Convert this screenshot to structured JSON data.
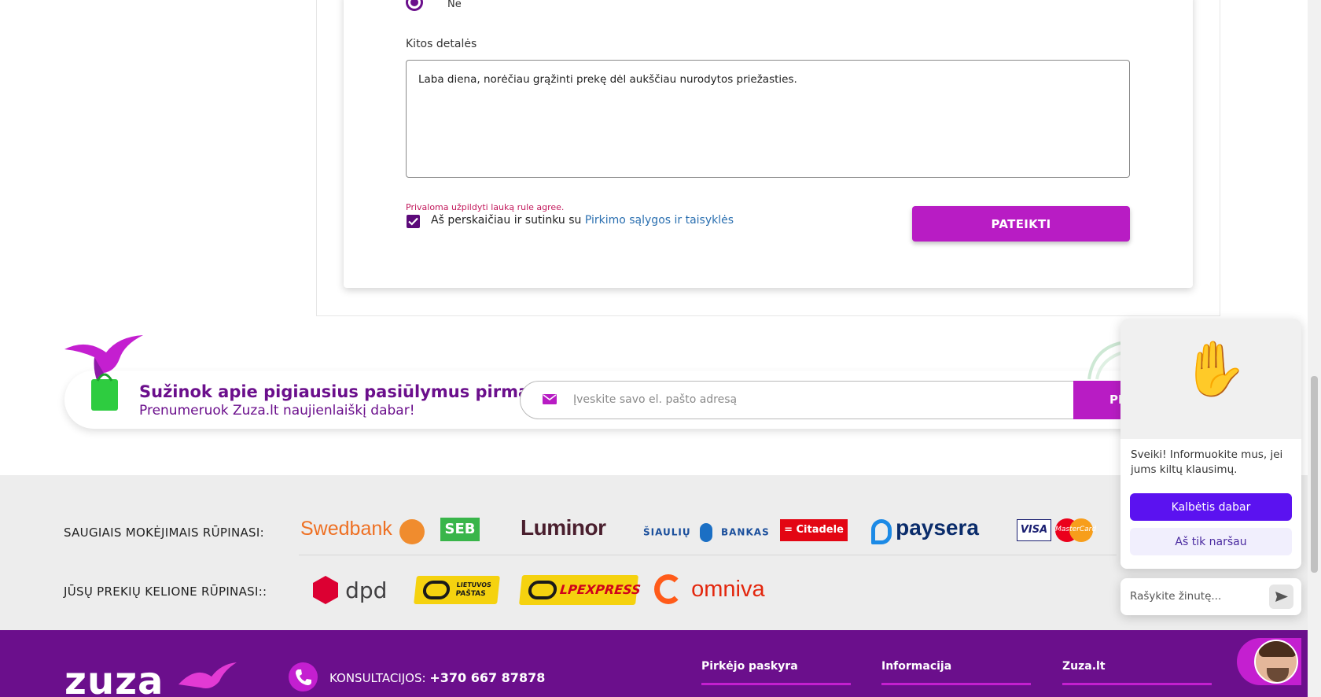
{
  "form": {
    "radio_label": "Ne",
    "details_label": "Kitos detalės",
    "details_value": "Laba diena, norėčiau grąžinti prekę dėl aukščiau nurodytos priežasties.",
    "error_message": "Privaloma užpildyti lauką rule agree.",
    "agree_text": "Aš perskaičiau ir sutinku su ",
    "agree_link": "Pirkimo sąlygos ir taisyklės",
    "submit_label": "PATEIKTI"
  },
  "newsletter": {
    "title": "Sužinok apie pigiausius pasiūlymus pirmas!",
    "subtitle": "Prenumeruok Zuza.lt naujienlaiškį dabar!",
    "email_placeholder": "Įveskite savo el. pašto adresą",
    "button_label": "PR"
  },
  "payments": {
    "payment_label": "SAUGIAIS MOKĖJIMAIS RŪPINASI:",
    "delivery_label": "JŪSŲ PREKIŲ KELIONE RŪPINASI::",
    "payment_logos": {
      "swedbank": "Swedbank",
      "seb": "SEB",
      "luminor": "Luminor",
      "siauliu_1": "ŠIAULIŲ",
      "siauliu_2": "BANKAS",
      "citadele": "Citadele",
      "paysera": "paysera",
      "visa": "VISA",
      "mastercard": "MasterCard"
    },
    "delivery_logos": {
      "dpd": "dpd",
      "lp_1": "LIETUVOS",
      "lp_2": "PAŠTAS",
      "lpexpress": "LPEXPRESS",
      "omniva": "omniva"
    }
  },
  "footer": {
    "logo": "zuza",
    "phone_label": "KONSULTACIJOS:",
    "phone_number": "+370 667 87878",
    "columns": [
      "Pirkėjo paskyra",
      "Informacija",
      "Zuza.lt"
    ]
  },
  "chat": {
    "message": "Sveiki! Informuokite mus, jei jums kiltų klausimų.",
    "primary_button": "Kalbėtis dabar",
    "secondary_button": "Aš tik naršau",
    "input_placeholder": "Rašykite žinutę..."
  },
  "colors": {
    "brand_purple": "#6b0f8c",
    "accent_magenta": "#b81cc4",
    "chat_primary": "#5b12f0",
    "link_blue": "#2a6fb0",
    "error_red": "#c2185b"
  },
  "icons": {
    "radio": "radio-selected-icon",
    "checkbox": "checkmark-icon",
    "mail": "envelope-icon",
    "bird": "hummingbird-bag-icon",
    "hand": "waving-hand-icon",
    "send": "send-arrow-icon",
    "phone": "phone-icon"
  }
}
